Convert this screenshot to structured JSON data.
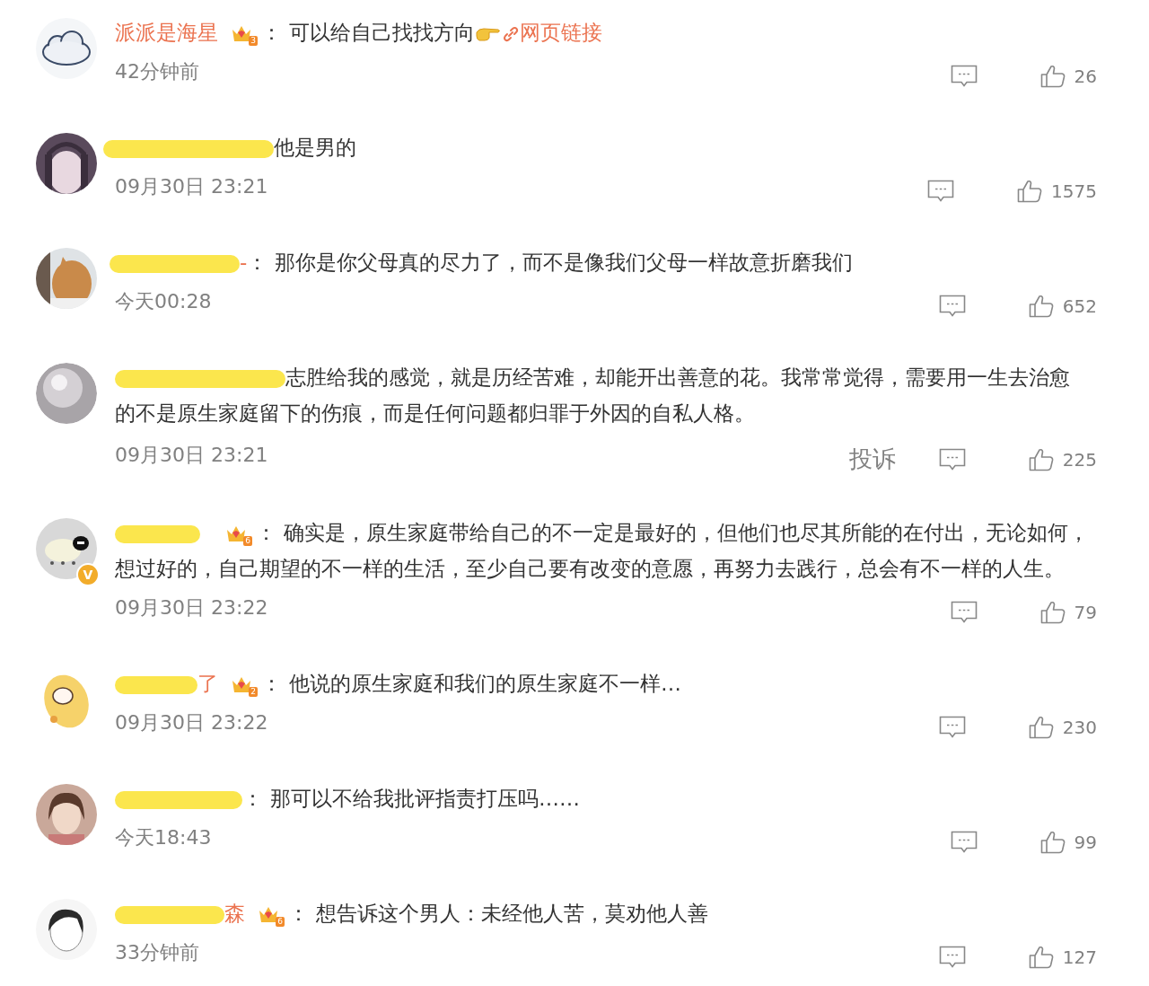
{
  "comments": [
    {
      "redacted": false,
      "name": "派派是海星",
      "crown_level": "3",
      "colon": "：",
      "segments": [
        {
          "kind": "text",
          "text": "可以给自己找找方向"
        },
        {
          "kind": "emoji"
        },
        {
          "kind": "link",
          "text": "网页链接"
        }
      ],
      "time": "42分钟前",
      "likes": "26"
    },
    {
      "redacted": true,
      "segments": [
        {
          "kind": "text",
          "text": "他是男的"
        }
      ],
      "time": "09月30日 23:21",
      "likes": "1575"
    },
    {
      "redacted": true,
      "name": "-",
      "colon": "：",
      "segments": [
        {
          "kind": "text",
          "text": "那你是你父母真的尽力了，而不是像我们父母一样故意折磨我们"
        }
      ],
      "time": "今天00:28",
      "likes": "652"
    },
    {
      "redacted": true,
      "segments": [
        {
          "kind": "text",
          "text": "志胜给我的感觉，就是历经苦难，却能开出善意的花。我常常觉得，需要用一生去治愈"
        },
        {
          "kind": "next_line",
          "text": "的不是原生家庭留下的伤痕，而是任何问题都归罪于外因的自私人格。"
        }
      ],
      "time": "09月30日 23:21",
      "report": "投诉",
      "likes": "225"
    },
    {
      "redacted": true,
      "verified_badge": "V",
      "crown_level": "6",
      "colon": "：",
      "segments": [
        {
          "kind": "text",
          "text": "确实是，原生家庭带给自己的不一定是最好的，但他们也尽其所能的在付出，无论如何，"
        },
        {
          "kind": "next_line",
          "text": "想过好的，自己期望的不一样的生活，至少自己要有改变的意愿，再努力去践行，总会有不一样的人生。"
        }
      ],
      "time": "09月30日 23:22",
      "likes": "79"
    },
    {
      "redacted": true,
      "name": "了",
      "crown_level": "2",
      "colon": "：",
      "segments": [
        {
          "kind": "text",
          "text": "他说的原生家庭和我们的原生家庭不一样…"
        }
      ],
      "time": "09月30日 23:22",
      "likes": "230"
    },
    {
      "redacted": true,
      "colon": "：",
      "segments": [
        {
          "kind": "text",
          "text": "那可以不给我批评指责打压吗……"
        }
      ],
      "time": "今天18:43",
      "likes": "99"
    },
    {
      "redacted": true,
      "name": "森",
      "crown_level": "6",
      "colon": "：",
      "segments": [
        {
          "kind": "text",
          "text": "想告诉这个男人：未经他人苦，莫劝他人善"
        }
      ],
      "time": "33分钟前",
      "likes": "127"
    }
  ]
}
